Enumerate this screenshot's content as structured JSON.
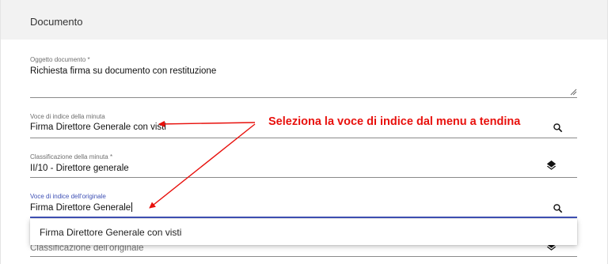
{
  "card": {
    "title": "Documento"
  },
  "fields": {
    "oggetto": {
      "label": "Oggetto documento *",
      "value": "Richiesta firma su documento con restituzione"
    },
    "voce_minuta": {
      "label": "Voce di indice della minuta",
      "value": "Firma Direttore Generale con visti",
      "icon": "search-icon"
    },
    "classificazione_minuta": {
      "label": "Classificazione della minuta *",
      "value": "II/10 - Direttore generale",
      "icon": "layers-icon"
    },
    "voce_originale": {
      "label": "Voce di indice dell'originale",
      "value": "Firma Direttore Generale",
      "icon": "search-icon"
    },
    "classificazione_originale": {
      "placeholder": "Classificazione dell'originale",
      "icon": "layers-icon"
    }
  },
  "dropdown": {
    "options": [
      "Firma Direttore Generale con visti"
    ]
  },
  "annotation": {
    "text": "Seleziona la voce di indice dal menu a tendina",
    "color": "#e8100c"
  }
}
